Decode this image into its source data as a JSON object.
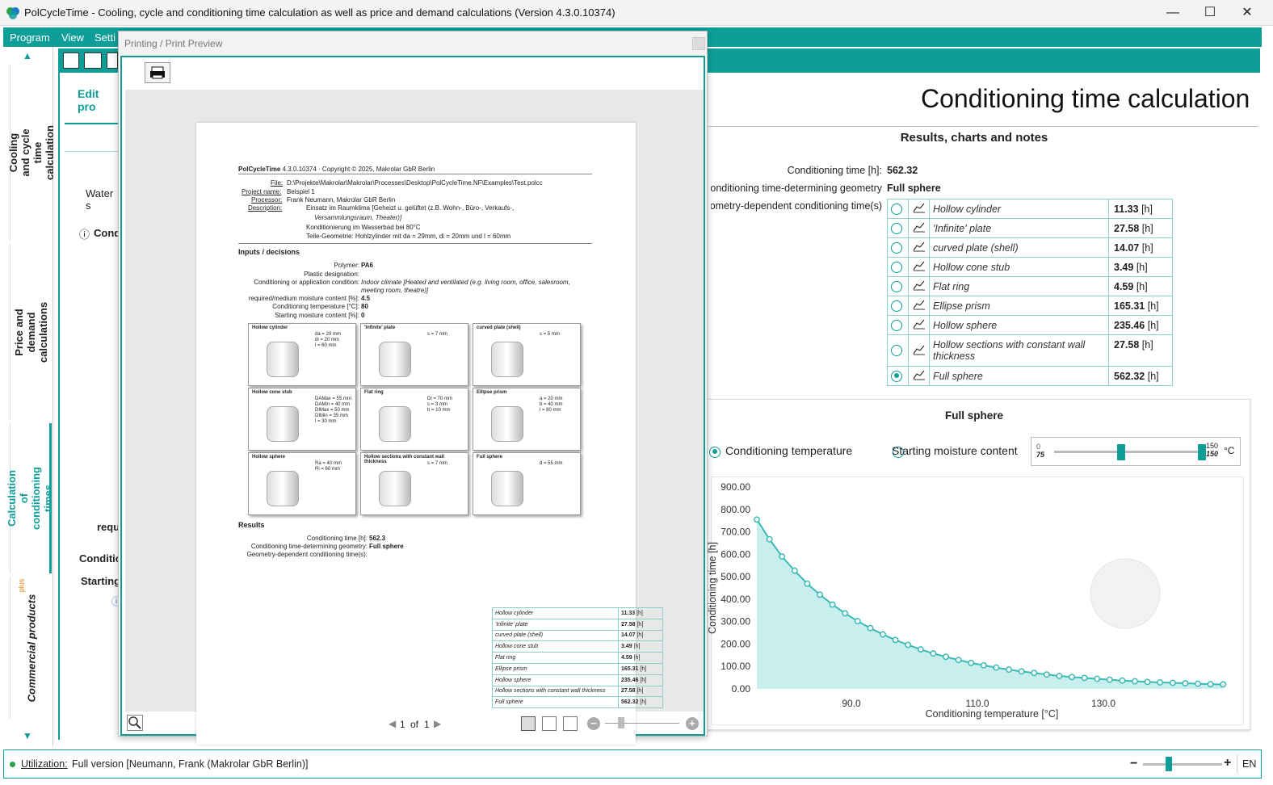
{
  "window": {
    "title": "PolCycleTime - Cooling, cycle and conditioning time calculation as well as price and demand calculations (Version 4.3.0.10374)",
    "minimize": "—",
    "maximize": "☐",
    "close": "✕"
  },
  "menu": {
    "program": "Program",
    "view": "View",
    "settings": "Setti"
  },
  "sidebar": {
    "tabs": [
      {
        "label": "Cooling and cycle time calculation"
      },
      {
        "label": "Price and demand calculations"
      },
      {
        "label": "Calculation of conditioning times"
      },
      {
        "label": "Commercial products",
        "badge": "plus"
      }
    ]
  },
  "left": {
    "edit": "Edit pro",
    "water": "Water s",
    "cond": "Cond",
    "requi": "requi",
    "conditio": "Conditio",
    "starting": "Starting"
  },
  "dialog": {
    "title": "Printing / Print Preview",
    "page_current": "1",
    "page_of": "of",
    "page_total": "1"
  },
  "paper": {
    "header_app": "PolCycleTime",
    "header_rest": "4.3.0.10374 · Copyright © 2025, Makrolar GbR Berlin",
    "file_label": "File:",
    "file_value": "D:\\Projekte\\Makrolar\\Makrolar\\Processes\\Desktop\\PolCycleTime.NF\\Examples\\Test.polcc",
    "project_label": "Project name:",
    "project_value": "Beispiel 1",
    "processor_label": "Processor:",
    "processor_value": "Frank Neumann, Makrolar GbR Berlin",
    "desc_label": "Description:",
    "desc_lines": [
      "Einsatz im Raumklima [Geheizt u. gelüftet (z.B. Wohn-, Büro-, Verkaufs-,",
      "Versammlungsraum, Theater)]",
      "Konditionierung im Wasserbad bei 80°C",
      "Teile-Geometrie: Hohlzylinder mit da = 29mm, di = 20mm und l = 60mm"
    ],
    "inputs_heading": "Inputs / decisions",
    "inputs": [
      {
        "label": "Polymer:",
        "value": "PA6"
      },
      {
        "label": "Plastic designation:",
        "value": ""
      },
      {
        "label": "Conditioning or application condition:",
        "value": "Indoor climate [Heated and ventilated (e.g. living room, office, salesroom,"
      },
      {
        "label": "",
        "value": "meeting room, theatre)]"
      },
      {
        "label": "required/medium moisture content [%]:",
        "value": "4.5"
      },
      {
        "label": "Conditioning temperature [°C]:",
        "value": "80"
      },
      {
        "label": "Starting moisture content [%]:",
        "value": "0"
      }
    ],
    "thumbs": [
      {
        "title": "Hollow cylinder",
        "params": [
          "da = 29 mm",
          "di = 20 mm",
          "l = 60 mm"
        ]
      },
      {
        "title": "'Infinite' plate",
        "params": [
          "s = 7 mm"
        ]
      },
      {
        "title": "curved plate (shell)",
        "params": [
          "s = 5 mm"
        ]
      },
      {
        "title": "Hollow cone stub",
        "params": [
          "DAMax = 55 mm",
          "DAMin = 40 mm",
          "DIMax = 50 mm",
          "DIMin = 35 mm",
          "l = 30 mm"
        ]
      },
      {
        "title": "Flat ring",
        "params": [
          "Di = 70 mm",
          "s = 3 mm",
          "b = 10 mm"
        ]
      },
      {
        "title": "Ellipse prism",
        "params": [
          "a = 20 mm",
          "b = 40 mm",
          "l = 80 mm"
        ]
      },
      {
        "title": "Hollow sphere",
        "params": [
          "Ra = 40 mm",
          "Ri = 60 mm"
        ]
      },
      {
        "title": "Hollow sections with constant wall thickness",
        "params": [
          "s = 7 mm"
        ]
      },
      {
        "title": "Full sphere",
        "params": [
          "d = 55 mm"
        ]
      }
    ],
    "results_heading": "Results",
    "res_time_label": "Conditioning time [h]:",
    "res_time_value": "562.3",
    "res_geom_label": "Conditioning time-determining geometry:",
    "res_geom_value": "Full sphere",
    "res_dep_label": "Geometry-dependent conditioning time(s):",
    "res_rows": [
      {
        "name": "Hollow cylinder",
        "value": "11.33"
      },
      {
        "name": "'Infinite' plate",
        "value": "27.58"
      },
      {
        "name": "curved plate (shell)",
        "value": "14.07"
      },
      {
        "name": "Hollow cone stub",
        "value": "3.49"
      },
      {
        "name": "Flat ring",
        "value": "4.59"
      },
      {
        "name": "Ellipse prism",
        "value": "165.31"
      },
      {
        "name": "Hollow sphere",
        "value": "235.46"
      },
      {
        "name": "Hollow sections with constant wall thickness",
        "value": "27.58"
      },
      {
        "name": "Full sphere",
        "value": "562.32"
      }
    ],
    "unit": "[h]"
  },
  "right": {
    "page_title": "Conditioning time calculation",
    "results_title": "Results, charts and notes",
    "time_label": "Conditioning time [h]:",
    "time_value": "562.32",
    "geom_label": "Conditioning time-determining geometry:",
    "geom_value": "Full sphere",
    "dep_label": "Geometry-dependent conditioning time(s):",
    "unit": "[h]",
    "rows": [
      {
        "name": "Hollow cylinder",
        "value": "11.33",
        "selected": false
      },
      {
        "name": "'Infinite' plate",
        "value": "27.58",
        "selected": false
      },
      {
        "name": "curved plate (shell)",
        "value": "14.07",
        "selected": false
      },
      {
        "name": "Hollow cone stub",
        "value": "3.49",
        "selected": false
      },
      {
        "name": "Flat ring",
        "value": "4.59",
        "selected": false
      },
      {
        "name": "Ellipse prism",
        "value": "165.31",
        "selected": false
      },
      {
        "name": "Hollow sphere",
        "value": "235.46",
        "selected": false
      },
      {
        "name": "Hollow sections with constant wall thickness",
        "value": "27.58",
        "selected": false
      },
      {
        "name": "Full sphere",
        "value": "562.32",
        "selected": true
      }
    ],
    "chart_title": "Full sphere",
    "opt_temp": "Conditioning temperature",
    "opt_moist": "Starting moisture content",
    "slider_min_top": "0",
    "slider_min_bot": "75",
    "slider_max_top": "150",
    "slider_max_bot": "150",
    "slider_unit": "°C"
  },
  "chart_data": {
    "type": "area",
    "title": "Full sphere",
    "xlabel": "Conditioning temperature [°C]",
    "ylabel": "Conditioning time [h]",
    "xlim": [
      75,
      150
    ],
    "ylim": [
      0,
      900
    ],
    "xticks": [
      90.0,
      110.0,
      130.0
    ],
    "xtick_labels": [
      "90.0",
      "110.0",
      "130.0"
    ],
    "yticks": [
      0,
      100,
      200,
      300,
      400,
      500,
      600,
      700,
      800,
      900
    ],
    "ytick_labels": [
      "0.00",
      "100.00",
      "200.00",
      "300.00",
      "400.00",
      "500.00",
      "600.00",
      "700.00",
      "800.00",
      "900.00"
    ],
    "x": [
      75,
      77,
      79,
      81,
      83,
      85,
      87,
      89,
      91,
      93,
      95,
      97,
      99,
      101,
      103,
      105,
      107,
      109,
      111,
      113,
      115,
      117,
      119,
      121,
      123,
      125,
      127,
      129,
      131,
      133,
      135,
      137,
      139,
      141,
      143,
      145,
      147,
      149
    ],
    "y": [
      755,
      667,
      590,
      527,
      469,
      420,
      376,
      337,
      302,
      271,
      243,
      218,
      196,
      176,
      158,
      143,
      129,
      116,
      105,
      95,
      86,
      78,
      71,
      64,
      58,
      53,
      49,
      45,
      41,
      37,
      34,
      31,
      29,
      27,
      25,
      23,
      21,
      20
    ],
    "series": [
      {
        "name": "Full sphere",
        "color": "#3bb9b4"
      }
    ],
    "grid": false
  },
  "status": {
    "utilization_label": "Utilization:",
    "utilization_value": "Full version [Neumann, Frank (Makrolar GbR Berlin)]",
    "lang": "EN"
  },
  "colors": {
    "accent": "#0e9e99",
    "fill": "#c8efee"
  }
}
